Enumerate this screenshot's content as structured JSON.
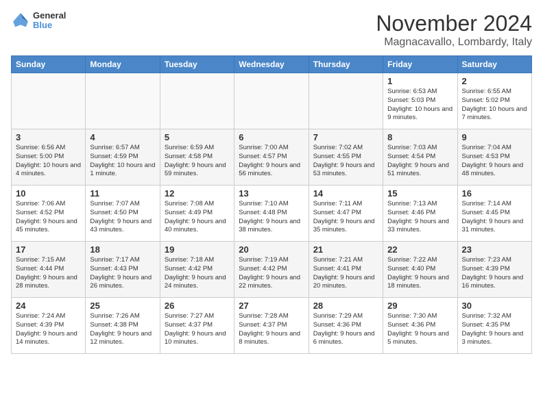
{
  "header": {
    "logo_general": "General",
    "logo_blue": "Blue",
    "month_title": "November 2024",
    "location": "Magnacavallo, Lombardy, Italy"
  },
  "columns": [
    "Sunday",
    "Monday",
    "Tuesday",
    "Wednesday",
    "Thursday",
    "Friday",
    "Saturday"
  ],
  "weeks": [
    [
      {
        "day": "",
        "info": ""
      },
      {
        "day": "",
        "info": ""
      },
      {
        "day": "",
        "info": ""
      },
      {
        "day": "",
        "info": ""
      },
      {
        "day": "",
        "info": ""
      },
      {
        "day": "1",
        "info": "Sunrise: 6:53 AM\nSunset: 5:03 PM\nDaylight: 10 hours and 9 minutes."
      },
      {
        "day": "2",
        "info": "Sunrise: 6:55 AM\nSunset: 5:02 PM\nDaylight: 10 hours and 7 minutes."
      }
    ],
    [
      {
        "day": "3",
        "info": "Sunrise: 6:56 AM\nSunset: 5:00 PM\nDaylight: 10 hours and 4 minutes."
      },
      {
        "day": "4",
        "info": "Sunrise: 6:57 AM\nSunset: 4:59 PM\nDaylight: 10 hours and 1 minute."
      },
      {
        "day": "5",
        "info": "Sunrise: 6:59 AM\nSunset: 4:58 PM\nDaylight: 9 hours and 59 minutes."
      },
      {
        "day": "6",
        "info": "Sunrise: 7:00 AM\nSunset: 4:57 PM\nDaylight: 9 hours and 56 minutes."
      },
      {
        "day": "7",
        "info": "Sunrise: 7:02 AM\nSunset: 4:55 PM\nDaylight: 9 hours and 53 minutes."
      },
      {
        "day": "8",
        "info": "Sunrise: 7:03 AM\nSunset: 4:54 PM\nDaylight: 9 hours and 51 minutes."
      },
      {
        "day": "9",
        "info": "Sunrise: 7:04 AM\nSunset: 4:53 PM\nDaylight: 9 hours and 48 minutes."
      }
    ],
    [
      {
        "day": "10",
        "info": "Sunrise: 7:06 AM\nSunset: 4:52 PM\nDaylight: 9 hours and 45 minutes."
      },
      {
        "day": "11",
        "info": "Sunrise: 7:07 AM\nSunset: 4:50 PM\nDaylight: 9 hours and 43 minutes."
      },
      {
        "day": "12",
        "info": "Sunrise: 7:08 AM\nSunset: 4:49 PM\nDaylight: 9 hours and 40 minutes."
      },
      {
        "day": "13",
        "info": "Sunrise: 7:10 AM\nSunset: 4:48 PM\nDaylight: 9 hours and 38 minutes."
      },
      {
        "day": "14",
        "info": "Sunrise: 7:11 AM\nSunset: 4:47 PM\nDaylight: 9 hours and 35 minutes."
      },
      {
        "day": "15",
        "info": "Sunrise: 7:13 AM\nSunset: 4:46 PM\nDaylight: 9 hours and 33 minutes."
      },
      {
        "day": "16",
        "info": "Sunrise: 7:14 AM\nSunset: 4:45 PM\nDaylight: 9 hours and 31 minutes."
      }
    ],
    [
      {
        "day": "17",
        "info": "Sunrise: 7:15 AM\nSunset: 4:44 PM\nDaylight: 9 hours and 28 minutes."
      },
      {
        "day": "18",
        "info": "Sunrise: 7:17 AM\nSunset: 4:43 PM\nDaylight: 9 hours and 26 minutes."
      },
      {
        "day": "19",
        "info": "Sunrise: 7:18 AM\nSunset: 4:42 PM\nDaylight: 9 hours and 24 minutes."
      },
      {
        "day": "20",
        "info": "Sunrise: 7:19 AM\nSunset: 4:42 PM\nDaylight: 9 hours and 22 minutes."
      },
      {
        "day": "21",
        "info": "Sunrise: 7:21 AM\nSunset: 4:41 PM\nDaylight: 9 hours and 20 minutes."
      },
      {
        "day": "22",
        "info": "Sunrise: 7:22 AM\nSunset: 4:40 PM\nDaylight: 9 hours and 18 minutes."
      },
      {
        "day": "23",
        "info": "Sunrise: 7:23 AM\nSunset: 4:39 PM\nDaylight: 9 hours and 16 minutes."
      }
    ],
    [
      {
        "day": "24",
        "info": "Sunrise: 7:24 AM\nSunset: 4:39 PM\nDaylight: 9 hours and 14 minutes."
      },
      {
        "day": "25",
        "info": "Sunrise: 7:26 AM\nSunset: 4:38 PM\nDaylight: 9 hours and 12 minutes."
      },
      {
        "day": "26",
        "info": "Sunrise: 7:27 AM\nSunset: 4:37 PM\nDaylight: 9 hours and 10 minutes."
      },
      {
        "day": "27",
        "info": "Sunrise: 7:28 AM\nSunset: 4:37 PM\nDaylight: 9 hours and 8 minutes."
      },
      {
        "day": "28",
        "info": "Sunrise: 7:29 AM\nSunset: 4:36 PM\nDaylight: 9 hours and 6 minutes."
      },
      {
        "day": "29",
        "info": "Sunrise: 7:30 AM\nSunset: 4:36 PM\nDaylight: 9 hours and 5 minutes."
      },
      {
        "day": "30",
        "info": "Sunrise: 7:32 AM\nSunset: 4:35 PM\nDaylight: 9 hours and 3 minutes."
      }
    ]
  ]
}
